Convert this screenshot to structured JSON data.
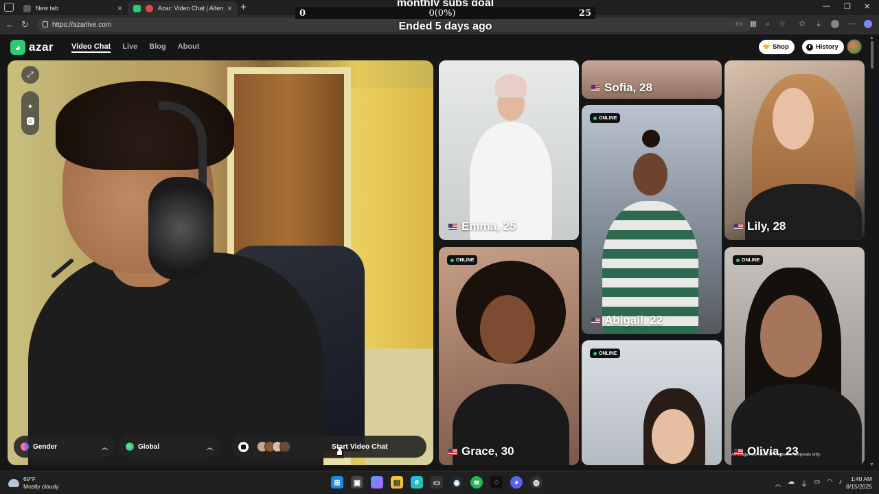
{
  "browser": {
    "tabs": [
      {
        "label": "New tab",
        "close": "×"
      },
      {
        "label": "Azar: Video Chat | Alternativ",
        "close": "×"
      }
    ],
    "new_tab": "+",
    "url": "https://azarlive.com",
    "window_controls": [
      "—",
      "❐",
      "✕"
    ]
  },
  "overlay": {
    "goal_title": "monthly subs goal",
    "goal_start": "0",
    "goal_progress": "0(0%)",
    "goal_target": "25",
    "status": "Ended 5 days ago"
  },
  "site": {
    "logo": "azar",
    "nav": [
      "Video Chat",
      "Live",
      "Blog",
      "About"
    ],
    "shop_label": "Shop",
    "history_label": "History",
    "controls": {
      "gender_label": "Gender",
      "region_label": "Global",
      "start_label": "Start Video Chat"
    },
    "online_label": "ONLINE",
    "disclaimer": "All images are used for illustrative purposes only.",
    "cards": [
      {
        "name": "Emma, 25"
      },
      {
        "name": "Sofia, 28"
      },
      {
        "name": "Abigail, 22"
      },
      {
        "name": "Lily, 28"
      },
      {
        "name": "Grace, 30"
      },
      {
        "name": "Olivia, 23"
      }
    ]
  },
  "taskbar": {
    "temperature": "69°F",
    "weather": "Mostly cloudy",
    "time": "1:40 AM",
    "date": "8/15/2025"
  },
  "colors": {
    "brand": "#2ecc71",
    "background": "#161616"
  }
}
